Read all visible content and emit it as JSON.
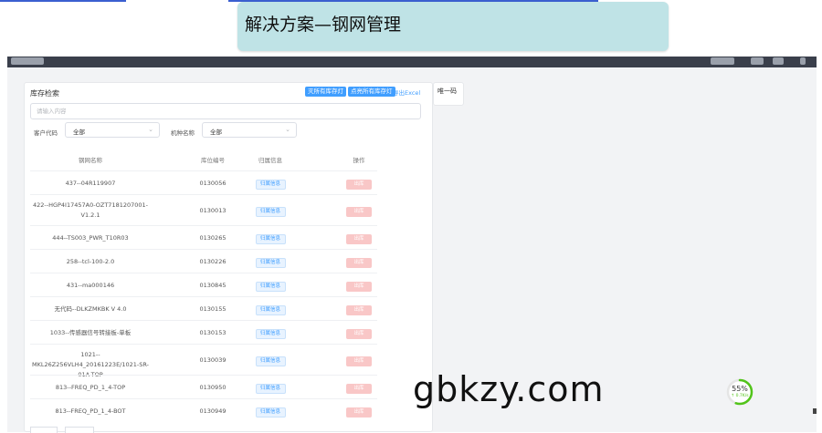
{
  "slide": {
    "title": "解决方案—钢网管理"
  },
  "panel": {
    "title": "库存检索",
    "buttons": [
      "灭所有库存灯",
      "点亮所有库存灯"
    ],
    "export_label": "导出Excel",
    "search_placeholder": "请输入内容",
    "filters": [
      {
        "label": "客户代码",
        "value": "全部"
      },
      {
        "label": "机种名称",
        "value": "全部"
      }
    ]
  },
  "table": {
    "headers": [
      "钢网名称",
      "库位编号",
      "归属信息",
      "操作"
    ],
    "info_label": "归属信息",
    "out_label": "出库",
    "rows": [
      {
        "name": "437--04R119907",
        "loc": "0130056"
      },
      {
        "name": "422--HGP4I17457A0-OZT7181207001-V1.2.1",
        "loc": "0130013"
      },
      {
        "name": "444--TS003_PWR_T10R03",
        "loc": "0130265"
      },
      {
        "name": "258--tcl-100-2.0",
        "loc": "0130226"
      },
      {
        "name": "431--ma000146",
        "loc": "0130845"
      },
      {
        "name": "无代码--DLKZMKBK V 4.0",
        "loc": "0130155"
      },
      {
        "name": "1033--传感器信号转接板-单板",
        "loc": "0130153"
      },
      {
        "name": "1021--MKL26Z256VLH4_20161223E/1021-SR-01A-TOP",
        "loc": "0130039"
      },
      {
        "name": "813--FREQ_PD_1_4-TOP",
        "loc": "0130950"
      },
      {
        "name": "813--FREQ_PD_1_4-BOT",
        "loc": "0130949"
      }
    ]
  },
  "side_panel": {
    "label": "唯一码"
  },
  "watermark": {
    "text": "gbkzy.com"
  },
  "progress": {
    "percent_label": "55%",
    "percent": 55,
    "speed_label": "↑ 0.7K/s",
    "color": "#52c41a"
  }
}
